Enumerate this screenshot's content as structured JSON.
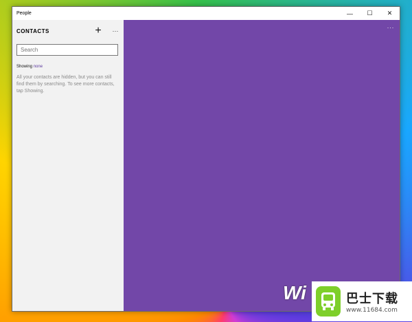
{
  "window": {
    "title": "People",
    "controls": {
      "minimize": "—",
      "maximize": "☐",
      "close": "✕"
    }
  },
  "sidebar": {
    "title": "CONTACTS",
    "add": "+",
    "more": "···",
    "search": {
      "placeholder": "Search",
      "value": ""
    },
    "showing_label": "Showing",
    "showing_value": "none",
    "hint": "All your contacts are hidden, but you can still find them by searching. To see more contacts, tap Showing."
  },
  "main": {
    "more": "···",
    "accent": "#7247a8"
  },
  "watermark": {
    "letters": "Wi",
    "brand": "巴士下载",
    "url": "www.11684.com"
  }
}
